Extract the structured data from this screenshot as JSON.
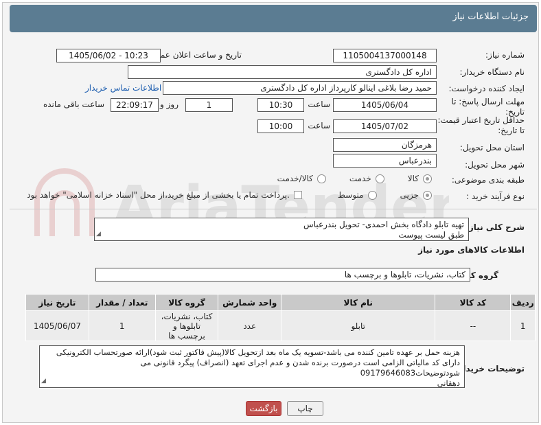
{
  "header": {
    "title": "جزئیات اطلاعات نیاز"
  },
  "fields": {
    "need_number": {
      "label": "شماره نیاز:",
      "value": "1105004137000148"
    },
    "announce_datetime": {
      "label": "تاریخ و ساعت اعلان عمومی:",
      "value": "1405/06/02 - 10:23"
    },
    "buyer_org": {
      "label": "نام دستگاه خریدار:",
      "value": "اداره کل دادگستری"
    },
    "requester": {
      "label": "ایجاد کننده درخواست:",
      "value": "حمید رضا  بلاغی اینالو کارپرداز اداره کل دادگستری"
    },
    "buyer_contact_link": "اطلاعات تماس خریدار",
    "reply_deadline": {
      "label": "مهلت ارسال پاسخ: تا تاریخ:",
      "date": "1405/06/04",
      "time_label": "ساعت",
      "time": "10:30",
      "days": "1",
      "days_label": "روز و",
      "remaining": "22:09:17",
      "remaining_label": "ساعت باقی مانده"
    },
    "price_validity": {
      "label": "حداقل تاریخ اعتبار قیمت: تا تاریخ:",
      "date": "1405/07/02",
      "time_label": "ساعت",
      "time": "10:00"
    },
    "province": {
      "label": "استان محل تحویل:",
      "value": "هرمزگان"
    },
    "city": {
      "label": "شهر محل تحویل:",
      "value": "بندرعباس"
    },
    "category": {
      "label": "طبقه بندی موضوعی:",
      "options": [
        "کالا",
        "خدمت",
        "کالا/خدمت"
      ],
      "selected": "کالا"
    },
    "process_type": {
      "label": "نوع فرآیند خرید :",
      "options": [
        "جزیی",
        "متوسط"
      ],
      "selected": "جزیی",
      "payment_note": "پرداخت تمام یا بخشی از مبلغ خرید،از محل \"اسناد خزانه اسلامی\" خواهد بود."
    },
    "general_description": {
      "label": "شرح کلی نیاز:",
      "value_line1": "تهیه  تابلو دادگاه بخش احمدی- تحویل بندرعباس",
      "value_line2": "طبق لیست پیوست"
    }
  },
  "goods_section": {
    "title": "اطلاعات کالاهای مورد نیاز",
    "group_label": "گروه کالا:",
    "group_value": "کتاب، نشریات، تابلوها و برچسب ها",
    "columns": [
      "ردیف",
      "کد کالا",
      "نام کالا",
      "واحد شمارش",
      "گروه کالا",
      "تعداد / مقدار",
      "تاریخ نیاز"
    ],
    "rows": [
      {
        "row": "1",
        "code": "--",
        "name": "تابلو",
        "unit": "عدد",
        "group": "کتاب، نشریات، تابلوها و برچسب ها",
        "qty": "1",
        "date": "1405/06/07"
      }
    ]
  },
  "buyer_notes": {
    "label": "توضیحات خریدار:",
    "line1": "هزینه حمل بر عهده تامین کننده می باشد-تسویه یک ماه بعد ازتحویل کالا(پیش فاکتور ثبت شود)ارائه صورتحساب الکترونیکی",
    "line2": "دارای کد مالیاتی الزامی است درصورت برنده شدن و عدم اجرای تعهد (انصراف) پیگرد قانونی می شودتوضیحات09179646083",
    "line3": "دهقانی"
  },
  "buttons": {
    "print": "چاپ",
    "back": "بازگشت"
  },
  "colors": {
    "header": "#5b7c92",
    "back_button": "#c0504d",
    "link": "#1f5fb0"
  },
  "icons": {
    "watermark": "aria-tender-logo"
  }
}
